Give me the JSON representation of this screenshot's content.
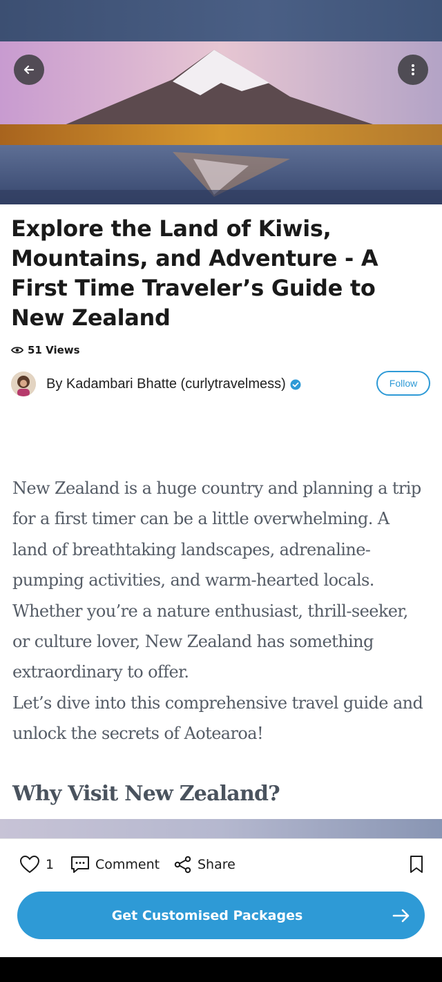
{
  "header": {
    "back_icon": "arrow-left-icon",
    "more_icon": "more-vertical-icon"
  },
  "article": {
    "title": "Explore the Land of Kiwis, Mountains, and Adventure - A First Time Traveler’s Guide to New Zealand",
    "views": "51 Views",
    "author": "By Kadambari Bhatte (curlytravelmess)",
    "follow_label": "Follow",
    "paragraphs": [
      "New Zealand is a huge country and planning a trip for a first timer can be a little overwhelming. A land of breathtaking landscapes, adrenaline-pumping activities, and warm-hearted locals. Whether you’re a nature enthusiast, thrill-seeker, or culture lover, New Zealand has something extraordinary to offer.",
      "Let’s dive into this comprehensive travel guide and unlock the secrets of Aotearoa!"
    ],
    "section_heading": "Why Visit New Zealand?"
  },
  "actions": {
    "like_count": "1",
    "comment_label": "Comment",
    "share_label": "Share"
  },
  "cta": {
    "label": "Get Customised Packages"
  },
  "colors": {
    "accent": "#2e9ad6",
    "verified": "#2e9ad6"
  }
}
